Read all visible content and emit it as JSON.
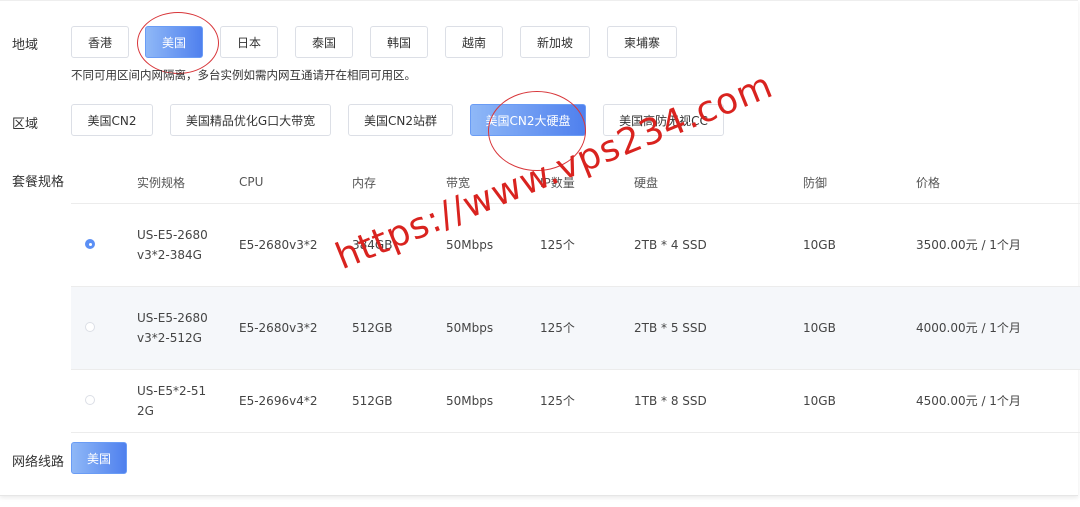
{
  "region": {
    "label": "地域",
    "options": [
      "香港",
      "美国",
      "日本",
      "泰国",
      "韩国",
      "越南",
      "新加坡",
      "柬埔寨"
    ],
    "selected": "美国",
    "note": "不同可用区间内网隔离，多台实例如需内网互通请开在相同可用区。"
  },
  "zone": {
    "label": "区域",
    "options": [
      "美国CN2",
      "美国精品优化G口大带宽",
      "美国CN2站群",
      "美国CN2大硬盘",
      "美国高防无视CC"
    ],
    "selected": "美国CN2大硬盘"
  },
  "plan": {
    "label": "套餐规格",
    "columns": [
      "实例规格",
      "CPU",
      "内存",
      "带宽",
      "IP数量",
      "硬盘",
      "防御",
      "价格"
    ],
    "rows": [
      {
        "selected": true,
        "spec": "US-E5-2680v3*2-384G",
        "cpu": "E5-2680v3*2",
        "memory": "384GB",
        "bandwidth": "50Mbps",
        "ips": "125个",
        "disk": "2TB * 4 SSD",
        "defense": "10GB",
        "price": "3500.00元 / 1个月"
      },
      {
        "selected": false,
        "spec": "US-E5-2680v3*2-512G",
        "cpu": "E5-2680v3*2",
        "memory": "512GB",
        "bandwidth": "50Mbps",
        "ips": "125个",
        "disk": "2TB * 5 SSD",
        "defense": "10GB",
        "price": "4000.00元 / 1个月"
      },
      {
        "selected": false,
        "spec": "US-E5*2-512G",
        "cpu": "E5-2696v4*2",
        "memory": "512GB",
        "bandwidth": "50Mbps",
        "ips": "125个",
        "disk": "1TB * 8 SSD",
        "defense": "10GB",
        "price": "4500.00元 / 1个月"
      }
    ]
  },
  "network": {
    "label": "网络线路",
    "options": [
      "美国"
    ],
    "selected": "美国"
  },
  "watermark": "https://www.vps234.com",
  "colors": {
    "accent": "#4f80ee",
    "annotation": "#d8363a"
  }
}
